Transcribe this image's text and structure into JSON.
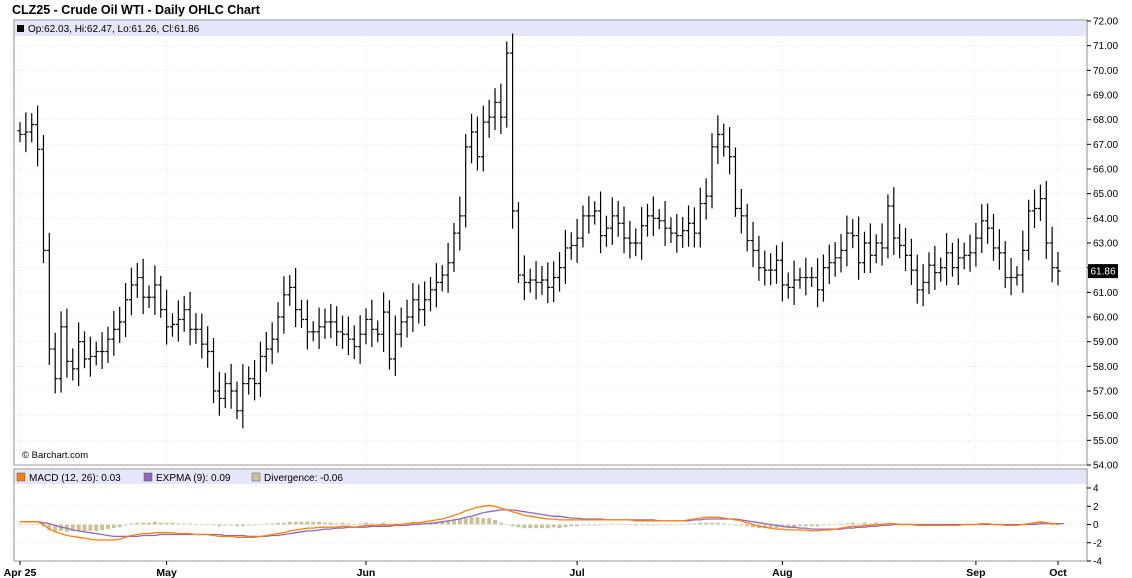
{
  "title": "CLZ25 - Crude Oil WTI - Daily OHLC Chart",
  "ohlc_legend": "Op:62.03, Hi:62.47, Lo:61.26, Cl:61.86",
  "watermark": "© Barchart.com",
  "last_price_label": "61.86",
  "colors": {
    "bar": "#000000",
    "header_band": "#e6e6fa",
    "grid": "#d9d9d9",
    "macd": "#ff7f0e",
    "expma": "#9467bd",
    "divergence": "#c9c39a",
    "price_tag": "#000000"
  },
  "macd_legend": {
    "macd": "MACD (12, 26): 0.03",
    "expma": "EXPMA (9): 0.09",
    "divergence": "Divergence: -0.06"
  },
  "chart_data": [
    {
      "type": "ohlc",
      "ylim": [
        54,
        72
      ],
      "y_ticks": [
        "72.00",
        "71.00",
        "70.00",
        "69.00",
        "68.00",
        "67.00",
        "66.00",
        "65.00",
        "64.00",
        "63.00",
        "62.00",
        "61.00",
        "60.00",
        "59.00",
        "58.00",
        "57.00",
        "56.00",
        "55.00",
        "54.00"
      ],
      "x_ticks": [
        "Apr 25",
        "May",
        "Jun",
        "Jul",
        "Aug",
        "Sep",
        "Oct"
      ],
      "grid": true,
      "closes": [
        67.4,
        67.5,
        67.8,
        66.8,
        62.7,
        58.7,
        57.5,
        59.6,
        58.2,
        57.9,
        59.0,
        58.3,
        58.4,
        58.6,
        58.6,
        59.1,
        59.5,
        59.8,
        60.7,
        61.3,
        61.6,
        60.8,
        60.8,
        61.3,
        60.3,
        59.6,
        59.7,
        59.9,
        60.3,
        59.5,
        59.5,
        58.9,
        58.6,
        57.0,
        56.7,
        57.3,
        57.0,
        56.2,
        57.3,
        57.5,
        57.3,
        58.4,
        58.7,
        59.1,
        60.0,
        60.9,
        61.2,
        60.3,
        59.9,
        59.4,
        59.4,
        59.6,
        59.8,
        59.8,
        59.4,
        59.3,
        59.1,
        58.8,
        59.3,
        59.9,
        59.5,
        59.3,
        60.2,
        58.3,
        59.3,
        59.8,
        60.0,
        60.7,
        60.3,
        60.7,
        61.1,
        61.4,
        61.7,
        62.2,
        63.4,
        64.1,
        66.9,
        67.5,
        66.5,
        67.9,
        68.1,
        68.7,
        68.1,
        70.7,
        64.3,
        61.7,
        61.4,
        61.5,
        61.4,
        61.5,
        61.2,
        61.6,
        62.0,
        62.8,
        62.9,
        63.2,
        64.1,
        64.1,
        64.3,
        63.3,
        63.6,
        64.1,
        63.8,
        63.2,
        63.0,
        63.0,
        63.7,
        64.1,
        64.0,
        63.9,
        63.6,
        63.4,
        63.3,
        63.5,
        63.8,
        63.4,
        64.6,
        64.9,
        66.9,
        67.4,
        66.9,
        66.5,
        64.4,
        64.1,
        63.1,
        62.7,
        62.0,
        61.9,
        61.9,
        62.3,
        61.3,
        61.2,
        61.5,
        61.6,
        61.6,
        61.6,
        61.1,
        62.0,
        62.2,
        62.4,
        62.7,
        63.4,
        63.3,
        62.2,
        63.0,
        62.5,
        63.0,
        62.8,
        64.5,
        63.2,
        62.9,
        62.5,
        61.9,
        61.1,
        61.4,
        62.1,
        61.8,
        62.0,
        62.6,
        62.0,
        62.4,
        62.5,
        62.6,
        63.2,
        63.9,
        63.6,
        62.8,
        62.6,
        61.6,
        61.6,
        61.7,
        62.7,
        64.3,
        64.4,
        64.8,
        63.0,
        62.0,
        61.86
      ],
      "last": 61.86
    },
    {
      "type": "line",
      "ylim": [
        -4,
        4
      ],
      "y_ticks": [
        "4",
        "2",
        "0",
        "-2",
        "-4"
      ],
      "series": [
        {
          "name": "MACD (12, 26)",
          "color": "#ff7f0e",
          "values": [
            0.3,
            0.3,
            0.3,
            0.3,
            0.0,
            -0.5,
            -0.8,
            -1.0,
            -1.2,
            -1.3,
            -1.4,
            -1.5,
            -1.6,
            -1.7,
            -1.7,
            -1.7,
            -1.7,
            -1.6,
            -1.4,
            -1.2,
            -1.1,
            -1.0,
            -1.0,
            -0.9,
            -0.9,
            -0.9,
            -0.9,
            -1.0,
            -1.0,
            -1.0,
            -1.1,
            -1.1,
            -1.1,
            -1.2,
            -1.3,
            -1.3,
            -1.3,
            -1.4,
            -1.4,
            -1.4,
            -1.4,
            -1.3,
            -1.2,
            -1.1,
            -1.0,
            -0.9,
            -0.7,
            -0.6,
            -0.5,
            -0.4,
            -0.4,
            -0.3,
            -0.3,
            -0.3,
            -0.3,
            -0.2,
            -0.2,
            -0.3,
            -0.2,
            -0.1,
            -0.1,
            -0.1,
            0.0,
            -0.1,
            0.0,
            0.0,
            0.1,
            0.2,
            0.2,
            0.3,
            0.4,
            0.5,
            0.6,
            0.8,
            1.0,
            1.2,
            1.5,
            1.7,
            1.9,
            2.0,
            2.1,
            2.0,
            1.8,
            1.6,
            1.4,
            1.2,
            1.0,
            0.9,
            0.8,
            0.7,
            0.6,
            0.6,
            0.5,
            0.5,
            0.5,
            0.5,
            0.5,
            0.5,
            0.5,
            0.5,
            0.5,
            0.5,
            0.5,
            0.5,
            0.5,
            0.4,
            0.4,
            0.4,
            0.4,
            0.4,
            0.4,
            0.4,
            0.4,
            0.4,
            0.5,
            0.6,
            0.7,
            0.8,
            0.8,
            0.8,
            0.7,
            0.6,
            0.5,
            0.4,
            0.2,
            0.0,
            -0.2,
            -0.3,
            -0.4,
            -0.5,
            -0.5,
            -0.6,
            -0.6,
            -0.6,
            -0.6,
            -0.7,
            -0.7,
            -0.6,
            -0.6,
            -0.5,
            -0.4,
            -0.3,
            -0.2,
            -0.2,
            -0.1,
            -0.1,
            0.0,
            0.0,
            0.1,
            0.1,
            0.0,
            0.0,
            0.0,
            -0.1,
            -0.1,
            -0.1,
            -0.1,
            -0.1,
            -0.1,
            -0.1,
            -0.1,
            0.0,
            0.0,
            0.0,
            0.1,
            0.1,
            0.0,
            0.0,
            -0.1,
            -0.1,
            -0.1,
            0.0,
            0.1,
            0.2,
            0.3,
            0.2,
            0.1,
            0.03
          ]
        },
        {
          "name": "EXPMA (9)",
          "color": "#9467bd",
          "values": [
            0.3,
            0.3,
            0.3,
            0.3,
            0.2,
            0.1,
            -0.1,
            -0.3,
            -0.4,
            -0.6,
            -0.7,
            -0.8,
            -0.9,
            -1.0,
            -1.1,
            -1.2,
            -1.3,
            -1.3,
            -1.3,
            -1.3,
            -1.3,
            -1.2,
            -1.2,
            -1.2,
            -1.1,
            -1.1,
            -1.1,
            -1.1,
            -1.1,
            -1.1,
            -1.1,
            -1.1,
            -1.1,
            -1.1,
            -1.1,
            -1.2,
            -1.2,
            -1.2,
            -1.2,
            -1.3,
            -1.3,
            -1.3,
            -1.3,
            -1.2,
            -1.2,
            -1.1,
            -1.0,
            -0.9,
            -0.8,
            -0.7,
            -0.7,
            -0.6,
            -0.5,
            -0.5,
            -0.4,
            -0.4,
            -0.3,
            -0.3,
            -0.3,
            -0.3,
            -0.2,
            -0.2,
            -0.2,
            -0.2,
            -0.1,
            -0.1,
            -0.1,
            0.0,
            0.0,
            0.1,
            0.1,
            0.2,
            0.3,
            0.4,
            0.5,
            0.6,
            0.8,
            0.9,
            1.1,
            1.3,
            1.4,
            1.5,
            1.6,
            1.6,
            1.6,
            1.5,
            1.4,
            1.3,
            1.2,
            1.1,
            1.0,
            0.9,
            0.9,
            0.8,
            0.7,
            0.7,
            0.6,
            0.6,
            0.6,
            0.6,
            0.5,
            0.5,
            0.5,
            0.5,
            0.5,
            0.5,
            0.5,
            0.5,
            0.5,
            0.4,
            0.4,
            0.4,
            0.4,
            0.4,
            0.4,
            0.5,
            0.5,
            0.6,
            0.6,
            0.6,
            0.6,
            0.6,
            0.6,
            0.5,
            0.4,
            0.3,
            0.2,
            0.1,
            0.0,
            -0.1,
            -0.2,
            -0.3,
            -0.3,
            -0.4,
            -0.4,
            -0.5,
            -0.5,
            -0.5,
            -0.5,
            -0.5,
            -0.5,
            -0.4,
            -0.4,
            -0.3,
            -0.3,
            -0.2,
            -0.2,
            -0.1,
            -0.1,
            0.0,
            0.0,
            0.0,
            0.0,
            0.0,
            0.0,
            0.0,
            0.0,
            0.0,
            0.0,
            0.0,
            0.0,
            0.0,
            0.0,
            0.0,
            0.0,
            0.0,
            0.0,
            0.0,
            0.0,
            0.0,
            0.0,
            0.0,
            0.0,
            0.0,
            0.1,
            0.1,
            0.1,
            0.1,
            0.09
          ]
        }
      ]
    }
  ]
}
